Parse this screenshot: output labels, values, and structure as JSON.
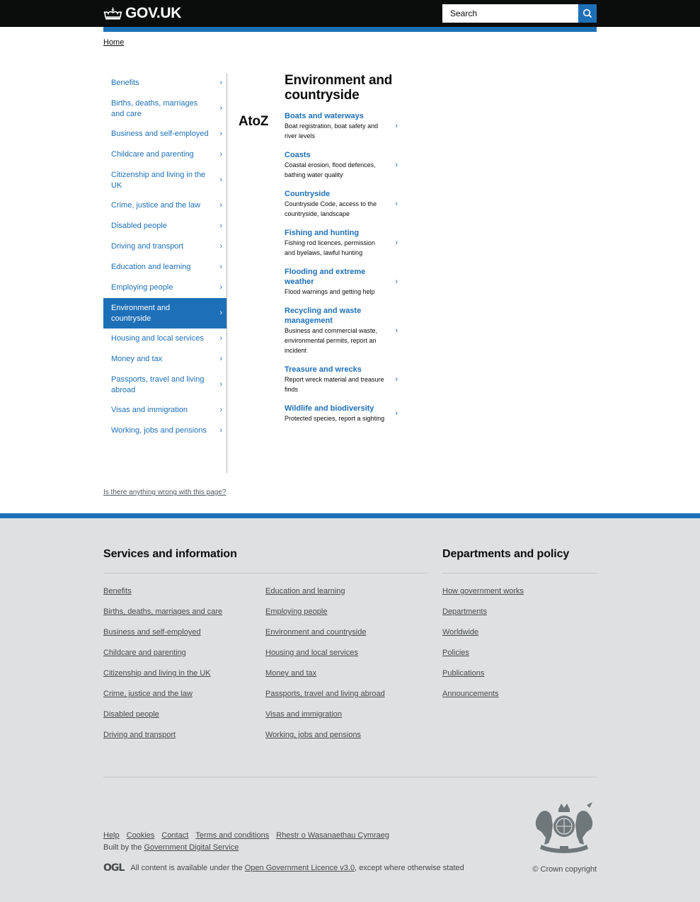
{
  "header": {
    "logo_text": "GOV.UK",
    "search_placeholder": "Search"
  },
  "breadcrumb": {
    "home": "Home"
  },
  "sidebar": {
    "items": [
      {
        "label": "Benefits",
        "active": false
      },
      {
        "label": "Births, deaths, marriages and care",
        "active": false
      },
      {
        "label": "Business and self-employed",
        "active": false
      },
      {
        "label": "Childcare and parenting",
        "active": false
      },
      {
        "label": "Citizenship and living in the UK",
        "active": false
      },
      {
        "label": "Crime, justice and the law",
        "active": false
      },
      {
        "label": "Disabled people",
        "active": false
      },
      {
        "label": "Driving and transport",
        "active": false
      },
      {
        "label": "Education and learning",
        "active": false
      },
      {
        "label": "Employing people",
        "active": false
      },
      {
        "label": "Environment and countryside",
        "active": true
      },
      {
        "label": "Housing and local services",
        "active": false
      },
      {
        "label": "Money and tax",
        "active": false
      },
      {
        "label": "Passports, travel and living abroad",
        "active": false
      },
      {
        "label": "Visas and immigration",
        "active": false
      },
      {
        "label": "Working, jobs and pensions",
        "active": false
      }
    ]
  },
  "atoz_label": "AtoZ",
  "content": {
    "title": "Environment and countryside",
    "topics": [
      {
        "title": "Boats and waterways",
        "desc": "Boat registration, boat safety and river levels"
      },
      {
        "title": "Coasts",
        "desc": "Coastal erosion, flood defences, bathing water quality"
      },
      {
        "title": "Countryside",
        "desc": "Countryside Code, access to the countryside, landscape"
      },
      {
        "title": "Fishing and hunting",
        "desc": "Fishing rod licences, permission and byelaws, lawful hunting"
      },
      {
        "title": "Flooding and extreme weather",
        "desc": "Flood warnings and getting help"
      },
      {
        "title": "Recycling and waste management",
        "desc": "Business and commercial waste, environmental permits, report an incident"
      },
      {
        "title": "Treasure and wrecks",
        "desc": "Report wreck material and treasure finds"
      },
      {
        "title": "Wildlife and biodiversity",
        "desc": "Protected species, report a sighting"
      }
    ]
  },
  "feedback_link": "Is there anything wrong with this page?",
  "footer": {
    "services_heading": "Services and information",
    "services_col1": [
      "Benefits",
      "Births, deaths, marriages and care",
      "Business and self-employed",
      "Childcare and parenting",
      "Citizenship and living in the UK",
      "Crime, justice and the law",
      "Disabled people",
      "Driving and transport"
    ],
    "services_col2": [
      "Education and learning",
      "Employing people",
      "Environment and countryside",
      "Housing and local services",
      "Money and tax",
      "Passports, travel and living abroad",
      "Visas and immigration",
      "Working, jobs and pensions"
    ],
    "depts_heading": "Departments and policy",
    "depts_links": [
      "How government works",
      "Departments",
      "Worldwide",
      "Policies",
      "Publications",
      "Announcements"
    ],
    "meta_links": [
      "Help",
      "Cookies",
      "Contact",
      "Terms and conditions",
      "Rhestr o Wasanaethau Cymraeg"
    ],
    "built_by_prefix": "Built by the ",
    "built_by_link": "Government Digital Service",
    "ogl_logo": "OGL",
    "licence_prefix": "All content is available under the ",
    "licence_link": "Open Government Licence v3.0",
    "licence_suffix": ", except where otherwise stated",
    "copyright": "© Crown copyright"
  },
  "colors": {
    "brand_blue": "#1d70b8",
    "header_black": "#0b0c0c",
    "footer_bg": "#dee0e2",
    "footer_text": "#454a4c"
  }
}
